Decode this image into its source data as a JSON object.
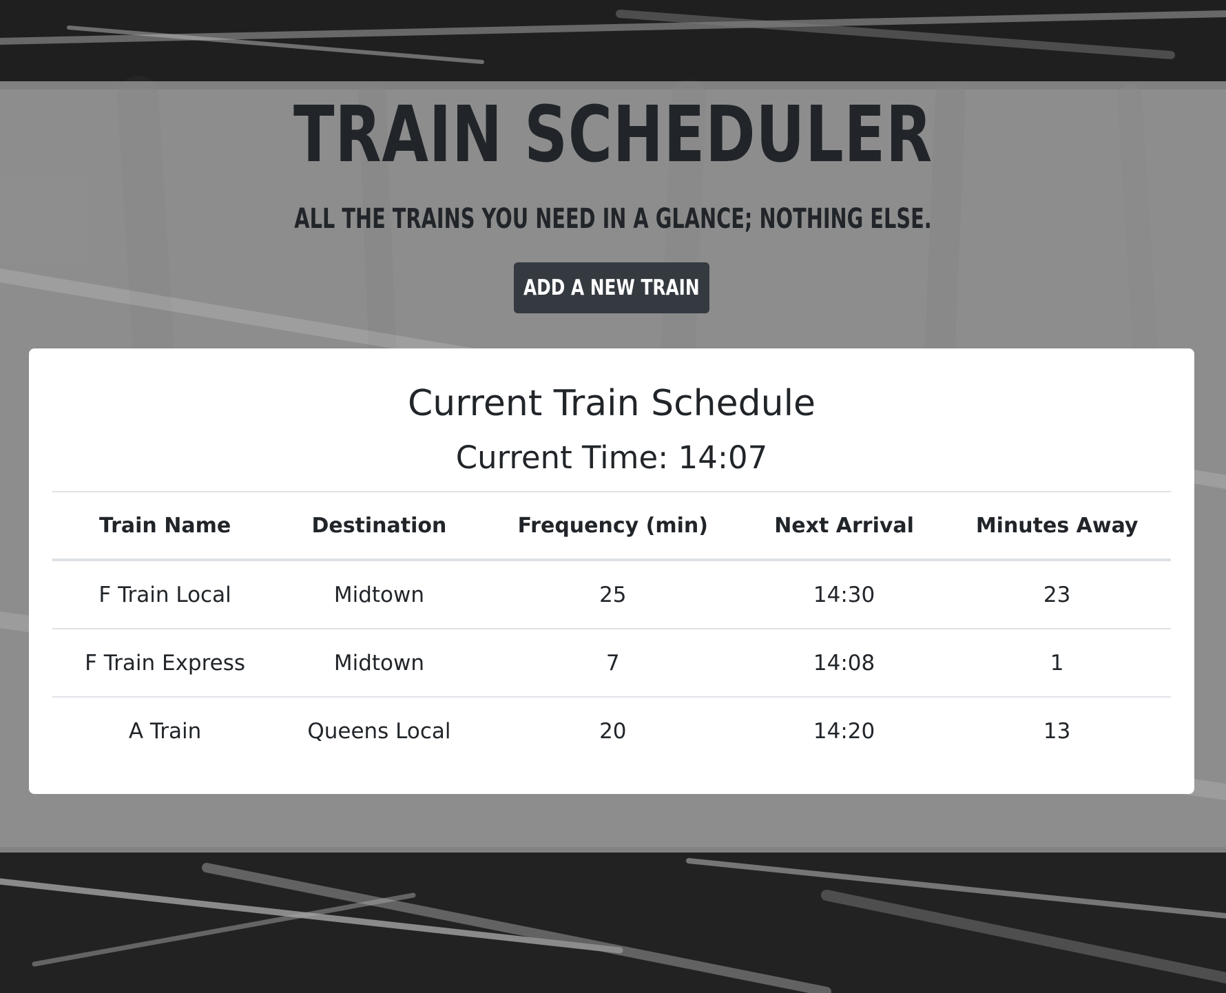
{
  "header": {
    "title": "TRAIN SCHEDULER",
    "subtitle": "ALL THE TRAINS YOU NEED IN A GLANCE; NOTHING ELSE.",
    "add_button_label": "ADD A NEW TRAIN"
  },
  "schedule": {
    "title": "Current Train Schedule",
    "current_time_label": "Current Time: 14:07",
    "columns": [
      "Train Name",
      "Destination",
      "Frequency (min)",
      "Next Arrival",
      "Minutes Away"
    ],
    "rows": [
      [
        "F Train Local",
        "Midtown",
        "25",
        "14:30",
        "23"
      ],
      [
        "F Train Express",
        "Midtown",
        "7",
        "14:08",
        "1"
      ],
      [
        "A Train",
        "Queens Local",
        "20",
        "14:20",
        "13"
      ]
    ]
  },
  "colors": {
    "button_bg": "#343a40",
    "text": "#212529",
    "card_bg": "#ffffff",
    "divider": "#dee2e6"
  }
}
